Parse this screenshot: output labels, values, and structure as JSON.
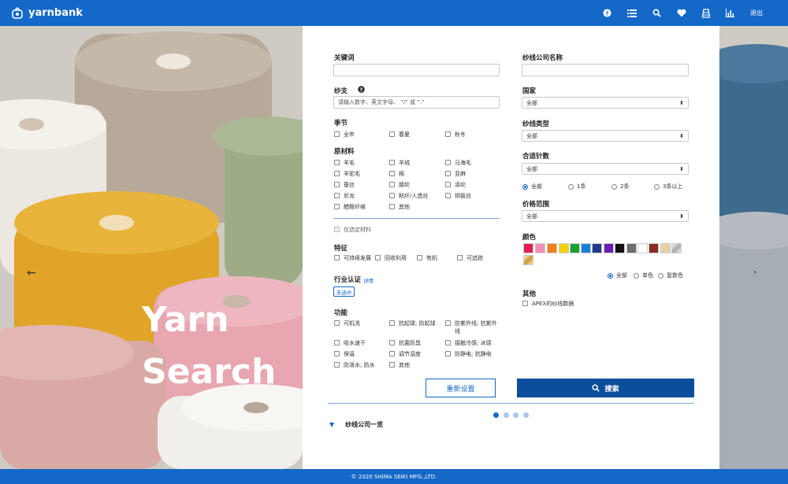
{
  "header": {
    "brand": "yarnbank",
    "logout": "退出"
  },
  "hero": {
    "title_line1": "Yarn",
    "title_line2": "Search"
  },
  "left": {
    "keyword_label": "关键词",
    "count_label": "纱支",
    "count_placeholder": "请输入数字、英文字母、 “/” 或 “.”",
    "season_label": "季节",
    "seasons": [
      "全年",
      "春夏",
      "秋冬"
    ],
    "material_label": "原材料",
    "materials": [
      "羊毛",
      "羊绒",
      "马海毛",
      "羊驼毛",
      "棉",
      "亚麻",
      "蚕丝",
      "腈纶",
      "涤纶",
      "尼龙",
      "粘纤/人造丝",
      "铜氨丝",
      "醋酸纤维",
      "其他"
    ],
    "selected_only": "仅选定材料",
    "feature_label": "特征",
    "features": [
      "可持续发展",
      "回收利用",
      "有机",
      "可追踪"
    ],
    "cert_label": "行业认证",
    "cert_detail": "详情",
    "cert_badge": "未选中",
    "function_label": "功能",
    "functions": [
      "可机洗",
      "抗起球; 防起球",
      "防紫外线; 抗紫外线",
      "吸水速干",
      "抗菌防臭",
      "接触冷感; 冰感",
      "保温",
      "调节湿度",
      "防静电; 抗静电",
      "防泼水; 防水",
      "其他"
    ]
  },
  "right": {
    "company_label": "纱线公司名称",
    "country_label": "国家",
    "country_value": "全部",
    "type_label": "纱线类型",
    "type_value": "全部",
    "gauge_label": "合适针数",
    "gauge_value": "全部",
    "gauge_options": [
      "全部",
      "1条",
      "2条",
      "3条以上"
    ],
    "price_label": "价格范围",
    "price_value": "全部",
    "color_label": "颜色",
    "colors": [
      "#e01f4f",
      "#f28fb5",
      "#f07f1e",
      "#f5d20f",
      "#1aa22e",
      "#1b7fe0",
      "#1f3a8c",
      "#6a1fb0",
      "#111111",
      "#6e6e6e",
      "#ffffff",
      "#8a2c20",
      "#e8d2a8"
    ],
    "color_modes": [
      "全部",
      "单色",
      "复数色"
    ],
    "other_label": "其他",
    "apex": "APEX的纱线数据"
  },
  "actions": {
    "reset": "重新设置",
    "search": "搜索"
  },
  "company_list": "纱线公司一览",
  "footer": "© 2020 SHIMA SEIKI MFG.,LTD."
}
